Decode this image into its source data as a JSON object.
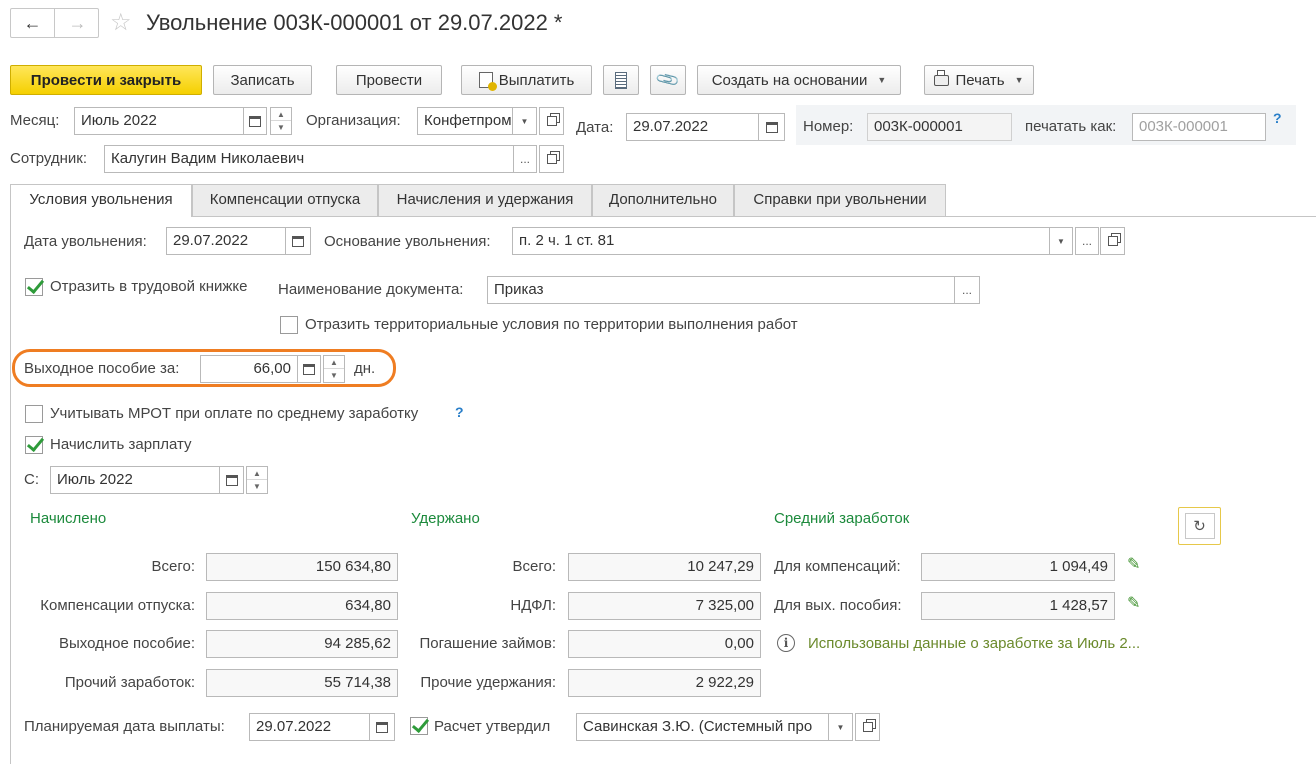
{
  "window": {
    "title": "Увольнение 003К-000001 от 29.07.2022 *"
  },
  "toolbar": {
    "post_close": "Провести и закрыть",
    "save": "Записать",
    "post": "Провести",
    "pay": "Выплатить",
    "create_based": "Создать на основании",
    "print": "Печать"
  },
  "header": {
    "month_label": "Месяц:",
    "month_value": "Июль 2022",
    "org_label": "Организация:",
    "org_value": "Конфетпром",
    "date_label": "Дата:",
    "date_value": "29.07.2022",
    "number_label": "Номер:",
    "number_value": "003К-000001",
    "print_as_label": "печатать как:",
    "print_as_placeholder": "003К-000001",
    "help": "?",
    "employee_label": "Сотрудник:",
    "employee_value": "Калугин Вадим Николаевич"
  },
  "tabs": [
    {
      "label": "Условия увольнения"
    },
    {
      "label": "Компенсации отпуска"
    },
    {
      "label": "Начисления и удержания"
    },
    {
      "label": "Дополнительно"
    },
    {
      "label": "Справки при увольнении"
    }
  ],
  "conditions": {
    "dismiss_date_label": "Дата увольнения:",
    "dismiss_date_value": "29.07.2022",
    "reason_label": "Основание увольнения:",
    "reason_value": "п. 2 ч. 1 ст. 81",
    "reflect_book_label": "Отразить в трудовой книжке",
    "reflect_book_checked": true,
    "doc_name_label": "Наименование документа:",
    "doc_name_value": "Приказ",
    "territorial_label": "Отразить территориальные условия по территории выполнения работ",
    "territorial_checked": false,
    "severance_label": "Выходное пособие за:",
    "severance_value": "66,00",
    "severance_unit": "дн.",
    "mrot_label": "Учитывать МРОТ при оплате по среднему заработку",
    "mrot_checked": false,
    "mrot_help": "?",
    "accrue_label": "Начислить зарплату",
    "accrue_checked": true,
    "from_label": "С:",
    "from_value": "Июль 2022"
  },
  "accrued": {
    "title": "Начислено",
    "rows": [
      {
        "label": "Всего:",
        "value": "150 634,80"
      },
      {
        "label": "Компенсации отпуска:",
        "value": "634,80"
      },
      {
        "label": "Выходное пособие:",
        "value": "94 285,62"
      },
      {
        "label": "Прочий заработок:",
        "value": "55 714,38"
      }
    ]
  },
  "withheld": {
    "title": "Удержано",
    "rows": [
      {
        "label": "Всего:",
        "value": "10 247,29"
      },
      {
        "label": "НДФЛ:",
        "value": "7 325,00"
      },
      {
        "label": "Погашение займов:",
        "value": "0,00"
      },
      {
        "label": "Прочие удержания:",
        "value": "2 922,29"
      }
    ]
  },
  "average": {
    "title": "Средний заработок",
    "rows": [
      {
        "label": "Для компенсаций:",
        "value": "1 094,49"
      },
      {
        "label": "Для вых. пособия:",
        "value": "1 428,57"
      }
    ],
    "info": "Использованы данные о заработке за Июль 2..."
  },
  "footer": {
    "pay_date_label": "Планируемая дата выплаты:",
    "pay_date_value": "29.07.2022",
    "approved_label": "Расчет утвердил",
    "approved_checked": true,
    "approver_value": "Савинская З.Ю. (Системный про"
  },
  "colors": {
    "accent_yellow": "#f5d000",
    "green_text": "#1c8a3c",
    "highlight_orange": "#ef7d22",
    "help_blue": "#2a7fc9"
  }
}
